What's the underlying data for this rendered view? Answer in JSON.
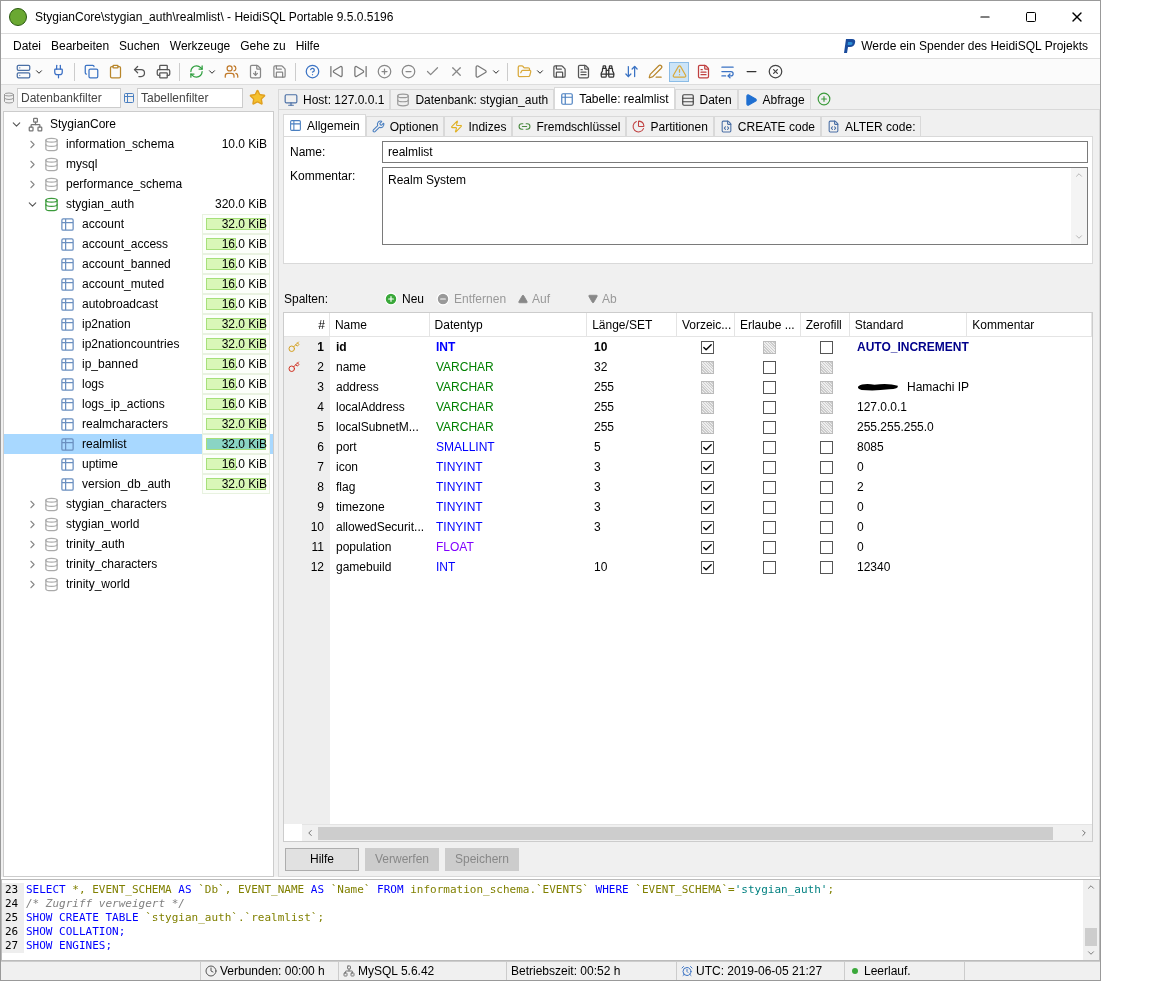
{
  "window": {
    "title": "StygianCore\\stygian_auth\\realmlist\\ - HeidiSQL Portable 9.5.0.5196"
  },
  "menu": [
    "Datei",
    "Bearbeiten",
    "Suchen",
    "Werkzeuge",
    "Gehe zu",
    "Hilfe"
  ],
  "donate": "Werde ein Spender des HeidiSQL Projekts",
  "filters": {
    "database_placeholder": "Datenbankfilter",
    "table_placeholder": "Tabellenfilter"
  },
  "tree": {
    "label": "StygianCore",
    "expanded": true,
    "children": [
      {
        "label": "information_schema",
        "size": "10.0 KiB",
        "expanded": false,
        "active": false
      },
      {
        "label": "mysql",
        "expanded": false,
        "active": false
      },
      {
        "label": "performance_schema",
        "expanded": false,
        "active": false
      },
      {
        "label": "stygian_auth",
        "size": "320.0 KiB",
        "expanded": true,
        "active": true,
        "children": [
          {
            "label": "account",
            "size": "32.0 KiB",
            "level": 1,
            "selected": false
          },
          {
            "label": "account_access",
            "size": "16.0 KiB",
            "level": 0.5,
            "selected": false
          },
          {
            "label": "account_banned",
            "size": "16.0 KiB",
            "level": 0.5,
            "selected": false
          },
          {
            "label": "account_muted",
            "size": "16.0 KiB",
            "level": 0.5,
            "selected": false
          },
          {
            "label": "autobroadcast",
            "size": "16.0 KiB",
            "level": 0.5,
            "selected": false
          },
          {
            "label": "ip2nation",
            "size": "32.0 KiB",
            "level": 1,
            "selected": false
          },
          {
            "label": "ip2nationcountries",
            "size": "32.0 KiB",
            "level": 1,
            "selected": false
          },
          {
            "label": "ip_banned",
            "size": "16.0 KiB",
            "level": 0.5,
            "selected": false
          },
          {
            "label": "logs",
            "size": "16.0 KiB",
            "level": 0.5,
            "selected": false
          },
          {
            "label": "logs_ip_actions",
            "size": "16.0 KiB",
            "level": 0.5,
            "selected": false
          },
          {
            "label": "realmcharacters",
            "size": "32.0 KiB",
            "level": 1,
            "selected": false
          },
          {
            "label": "realmlist",
            "size": "32.0 KiB",
            "level": 1,
            "selected": true
          },
          {
            "label": "uptime",
            "size": "16.0 KiB",
            "level": 0.5,
            "selected": false
          },
          {
            "label": "version_db_auth",
            "size": "32.0 KiB",
            "level": 1,
            "selected": false
          }
        ]
      },
      {
        "label": "stygian_characters",
        "expanded": false,
        "active": false
      },
      {
        "label": "stygian_world",
        "expanded": false,
        "active": false
      },
      {
        "label": "trinity_auth",
        "expanded": false,
        "active": false
      },
      {
        "label": "trinity_characters",
        "expanded": false,
        "active": false
      },
      {
        "label": "trinity_world",
        "expanded": false,
        "active": false
      }
    ]
  },
  "main_tabs": [
    {
      "label": "Host: 127.0.0.1",
      "kind": "host",
      "selected": false
    },
    {
      "label": "Datenbank: stygian_auth",
      "kind": "database",
      "selected": false
    },
    {
      "label": "Tabelle: realmlist",
      "kind": "table",
      "selected": true
    },
    {
      "label": "Daten",
      "kind": "data",
      "selected": false
    },
    {
      "label": "Abfrage",
      "kind": "query",
      "selected": false
    }
  ],
  "sub_tabs": [
    {
      "label": "Allgemein",
      "kind": "general",
      "selected": true
    },
    {
      "label": "Optionen",
      "kind": "options",
      "selected": false
    },
    {
      "label": "Indizes",
      "kind": "indexes",
      "selected": false
    },
    {
      "label": "Fremdschlüssel",
      "kind": "foreign",
      "selected": false
    },
    {
      "label": "Partitionen",
      "kind": "partitions",
      "selected": false
    },
    {
      "label": "CREATE code",
      "kind": "code",
      "selected": false
    },
    {
      "label": "ALTER code:",
      "kind": "code",
      "selected": false
    }
  ],
  "form": {
    "name_label": "Name:",
    "name_value": "realmlist",
    "comment_label": "Kommentar:",
    "comment_value": "Realm System"
  },
  "columns_toolbar": {
    "label": "Spalten:",
    "buttons": [
      {
        "label": "Neu",
        "kind": "add",
        "disabled": false
      },
      {
        "label": "Entfernen",
        "kind": "remove",
        "disabled": true
      },
      {
        "label": "Auf",
        "kind": "up",
        "disabled": true
      },
      {
        "label": "Ab",
        "kind": "down",
        "disabled": true
      }
    ]
  },
  "table": {
    "columns": [
      "#",
      "Name",
      "Datentyp",
      "Länge/SET",
      "Vorzeic...",
      "Erlaube ...",
      "Zerofill",
      "Standard",
      "Kommentar"
    ],
    "rows": [
      {
        "num": "1",
        "name": "id",
        "type": "INT",
        "color": "#0000ff",
        "length": "10",
        "default": "AUTO_INCREMENT",
        "kind": "primary",
        "unsigned": {
          "checked": true,
          "disabled": false
        },
        "null": {
          "checked": false,
          "disabled": true
        },
        "zerofill": {
          "checked": false,
          "disabled": false
        }
      },
      {
        "num": "2",
        "name": "name",
        "type": "VARCHAR",
        "color": "#008000",
        "length": "32",
        "kind": "unique",
        "unsigned": {
          "checked": false,
          "disabled": true
        },
        "null": {
          "checked": false,
          "disabled": false
        },
        "zerofill": {
          "checked": false,
          "disabled": true
        }
      },
      {
        "num": "3",
        "name": "address",
        "type": "VARCHAR",
        "color": "#008000",
        "length": "255",
        "default": "Hamachi IP",
        "redacted": true,
        "unsigned": {
          "checked": false,
          "disabled": true
        },
        "null": {
          "checked": false,
          "disabled": false
        },
        "zerofill": {
          "checked": false,
          "disabled": true
        }
      },
      {
        "num": "4",
        "name": "localAddress",
        "type": "VARCHAR",
        "color": "#008000",
        "length": "255",
        "default": "127.0.0.1",
        "unsigned": {
          "checked": false,
          "disabled": true
        },
        "null": {
          "checked": false,
          "disabled": false
        },
        "zerofill": {
          "checked": false,
          "disabled": true
        }
      },
      {
        "num": "5",
        "name": "localSubnetM...",
        "type": "VARCHAR",
        "color": "#008000",
        "length": "255",
        "default": "255.255.255.0",
        "unsigned": {
          "checked": false,
          "disabled": true
        },
        "null": {
          "checked": false,
          "disabled": false
        },
        "zerofill": {
          "checked": false,
          "disabled": true
        }
      },
      {
        "num": "6",
        "name": "port",
        "type": "SMALLINT",
        "color": "#0000ff",
        "length": "5",
        "default": "8085",
        "unsigned": {
          "checked": true,
          "disabled": false
        },
        "null": {
          "checked": false,
          "disabled": false
        },
        "zerofill": {
          "checked": false,
          "disabled": false
        }
      },
      {
        "num": "7",
        "name": "icon",
        "type": "TINYINT",
        "color": "#0000ff",
        "length": "3",
        "default": "0",
        "unsigned": {
          "checked": true,
          "disabled": false
        },
        "null": {
          "checked": false,
          "disabled": false
        },
        "zerofill": {
          "checked": false,
          "disabled": false
        }
      },
      {
        "num": "8",
        "name": "flag",
        "type": "TINYINT",
        "color": "#0000ff",
        "length": "3",
        "default": "2",
        "unsigned": {
          "checked": true,
          "disabled": false
        },
        "null": {
          "checked": false,
          "disabled": false
        },
        "zerofill": {
          "checked": false,
          "disabled": false
        }
      },
      {
        "num": "9",
        "name": "timezone",
        "type": "TINYINT",
        "color": "#0000ff",
        "length": "3",
        "default": "0",
        "unsigned": {
          "checked": true,
          "disabled": false
        },
        "null": {
          "checked": false,
          "disabled": false
        },
        "zerofill": {
          "checked": false,
          "disabled": false
        }
      },
      {
        "num": "10",
        "name": "allowedSecurit...",
        "type": "TINYINT",
        "color": "#0000ff",
        "length": "3",
        "default": "0",
        "unsigned": {
          "checked": true,
          "disabled": false
        },
        "null": {
          "checked": false,
          "disabled": false
        },
        "zerofill": {
          "checked": false,
          "disabled": false
        }
      },
      {
        "num": "11",
        "name": "population",
        "type": "FLOAT",
        "color": "#8000ff",
        "default": "0",
        "unsigned": {
          "checked": true,
          "disabled": false
        },
        "null": {
          "checked": false,
          "disabled": false
        },
        "zerofill": {
          "checked": false,
          "disabled": false
        }
      },
      {
        "num": "12",
        "name": "gamebuild",
        "type": "INT",
        "color": "#0000ff",
        "length": "10",
        "default": "12340",
        "unsigned": {
          "checked": true,
          "disabled": false
        },
        "null": {
          "checked": false,
          "disabled": false
        },
        "zerofill": {
          "checked": false,
          "disabled": false
        }
      }
    ]
  },
  "buttons": [
    {
      "label": "Hilfe",
      "disabled": false
    },
    {
      "label": "Verwerfen",
      "disabled": true
    },
    {
      "label": "Speichern",
      "disabled": true
    }
  ],
  "sql_log": [
    {
      "num": "23",
      "tokens": [
        {
          "kind": "keyword",
          "text": "SELECT"
        },
        {
          "kind": "text",
          "text": " *, EVENT_SCHEMA "
        },
        {
          "kind": "keyword",
          "text": "AS"
        },
        {
          "kind": "text",
          "text": " `Db`, EVENT_NAME "
        },
        {
          "kind": "keyword",
          "text": "AS"
        },
        {
          "kind": "text",
          "text": " `Name` "
        },
        {
          "kind": "keyword",
          "text": "FROM"
        },
        {
          "kind": "text",
          "text": " information_schema.`EVENTS` "
        },
        {
          "kind": "keyword",
          "text": "WHERE"
        },
        {
          "kind": "text",
          "text": " `EVENT_SCHEMA`="
        },
        {
          "kind": "string",
          "text": "'stygian_auth'"
        },
        {
          "kind": "text",
          "text": ";"
        }
      ]
    },
    {
      "num": "24",
      "tokens": [
        {
          "kind": "comment",
          "text": "/* Zugriff verweigert */"
        }
      ]
    },
    {
      "num": "25",
      "tokens": [
        {
          "kind": "keyword",
          "text": "SHOW CREATE TABLE"
        },
        {
          "kind": "text",
          "text": " `stygian_auth`.`realmlist`;"
        }
      ]
    },
    {
      "num": "26",
      "tokens": [
        {
          "kind": "keyword",
          "text": "SHOW COLLATION;"
        }
      ]
    },
    {
      "num": "27",
      "tokens": [
        {
          "kind": "keyword",
          "text": "SHOW ENGINES;"
        }
      ]
    }
  ],
  "status_bar": [
    {
      "text": "Verbunden: 00:00 h",
      "kind": "clock"
    },
    {
      "text": "MySQL 5.6.42",
      "kind": "server"
    },
    {
      "text": "Betriebszeit: 00:52 h",
      "kind": "plain"
    },
    {
      "text": "UTC: 2019-06-05 21:27",
      "kind": "alarm"
    },
    {
      "text": "Leerlauf.",
      "kind": "idle"
    }
  ]
}
